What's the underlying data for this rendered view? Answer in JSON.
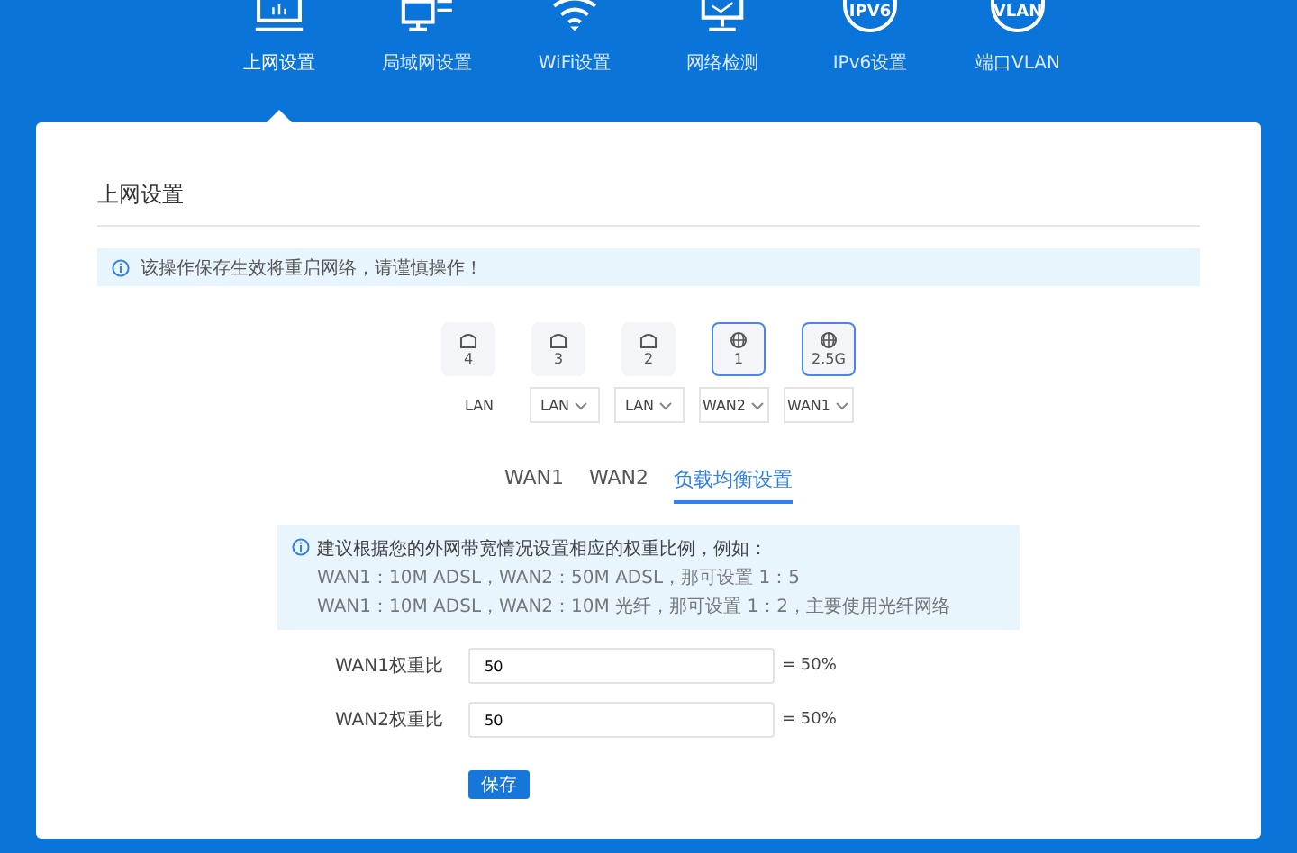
{
  "nav": [
    {
      "label": "上网设置",
      "kind": "monitor",
      "selected": true
    },
    {
      "label": "局域网设置",
      "kind": "computers",
      "selected": false
    },
    {
      "label": "WiFi设置",
      "kind": "wifi",
      "selected": false
    },
    {
      "label": "网络检测",
      "kind": "check",
      "selected": false
    },
    {
      "label": "IPv6设置",
      "kind": "badge",
      "badge": "IPV6",
      "selected": false
    },
    {
      "label": "端口VLAN",
      "kind": "badge",
      "badge": "VLAN",
      "selected": false
    }
  ],
  "page_title": "上网设置",
  "notice": "该操作保存生效将重启网络，请谨慎操作！",
  "ports": [
    {
      "number": "4",
      "kind": "lan",
      "selected": false
    },
    {
      "number": "3",
      "kind": "lan",
      "selected": false
    },
    {
      "number": "2",
      "kind": "lan",
      "selected": false
    },
    {
      "number": "1",
      "kind": "wan",
      "selected": true
    },
    {
      "number": "2.5G",
      "kind": "wan",
      "selected": true
    }
  ],
  "port_modes": [
    {
      "value": "LAN",
      "kind": "label"
    },
    {
      "value": "LAN",
      "kind": "select"
    },
    {
      "value": "LAN",
      "kind": "select"
    },
    {
      "value": "WAN2",
      "kind": "select"
    },
    {
      "value": "WAN1",
      "kind": "select"
    }
  ],
  "tabs": [
    {
      "label": "WAN1",
      "selected": false
    },
    {
      "label": "WAN2",
      "selected": false
    },
    {
      "label": "负载均衡设置",
      "selected": true
    }
  ],
  "hint_lines": [
    "建议根据您的外网带宽情况设置相应的权重比例，例如：",
    "WAN1：10M ADSL，WAN2：50M ADSL，那可设置 1：5",
    "WAN1：10M ADSL，WAN2：10M 光纤，那可设置 1：2，主要使用光纤网络"
  ],
  "weights": [
    {
      "label": "WAN1权重比",
      "value": "50",
      "ratio": "= 50%"
    },
    {
      "label": "WAN2权重比",
      "value": "50",
      "ratio": "= 50%"
    }
  ],
  "save_button": "保存"
}
